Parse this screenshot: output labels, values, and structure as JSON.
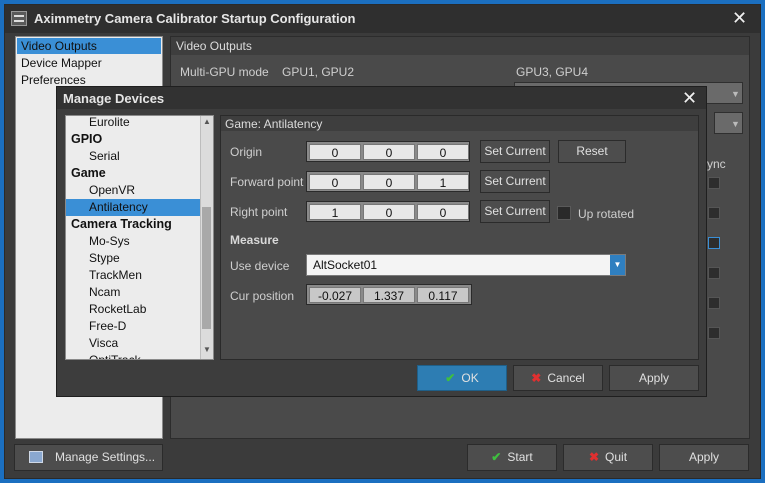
{
  "outer": {
    "title": "Aximmetry Camera Calibrator Startup Configuration",
    "sidebar": [
      "Video Outputs",
      "Device Mapper",
      "Preferences"
    ],
    "panel_title": "Video Outputs",
    "multi_gpu_label": "Multi-GPU mode",
    "gpu12": "GPU1, GPU2",
    "gpu34": "GPU3, GPU4",
    "sync_fragment": "ync",
    "manage_settings": "Manage Settings...",
    "start": "Start",
    "quit": "Quit",
    "apply": "Apply"
  },
  "dialog": {
    "title": "Manage Devices",
    "tree": [
      {
        "label": "Eurolite",
        "kind": "child"
      },
      {
        "label": "GPIO",
        "kind": "cat"
      },
      {
        "label": "Serial",
        "kind": "child"
      },
      {
        "label": "Game",
        "kind": "cat"
      },
      {
        "label": "OpenVR",
        "kind": "child"
      },
      {
        "label": "Antilatency",
        "kind": "child",
        "selected": true
      },
      {
        "label": "Camera Tracking",
        "kind": "cat"
      },
      {
        "label": "Mo-Sys",
        "kind": "child"
      },
      {
        "label": "Stype",
        "kind": "child"
      },
      {
        "label": "TrackMen",
        "kind": "child"
      },
      {
        "label": "Ncam",
        "kind": "child"
      },
      {
        "label": "RocketLab",
        "kind": "child"
      },
      {
        "label": "Free-D",
        "kind": "child"
      },
      {
        "label": "Visca",
        "kind": "child"
      },
      {
        "label": "OptiTrack",
        "kind": "child"
      }
    ],
    "panel_title": "Game: Antilatency",
    "origin_label": "Origin",
    "origin": [
      "0",
      "0",
      "0"
    ],
    "forward_label": "Forward point",
    "forward": [
      "0",
      "0",
      "1"
    ],
    "right_label": "Right point",
    "right": [
      "1",
      "0",
      "0"
    ],
    "set_current": "Set Current",
    "reset": "Reset",
    "up_rotated": "Up rotated",
    "measure_heading": "Measure",
    "use_device_label": "Use device",
    "use_device_value": "AltSocket01",
    "cur_position_label": "Cur position",
    "cur_position": [
      "-0.027",
      "1.337",
      "0.117"
    ],
    "ok": "OK",
    "cancel": "Cancel",
    "apply": "Apply"
  },
  "colors": {
    "desktop": "#1b6fc0",
    "selection": "#3a8fd6",
    "ok_button": "#2d7db3",
    "check": "#3fbf3f",
    "cross": "#e03030"
  }
}
